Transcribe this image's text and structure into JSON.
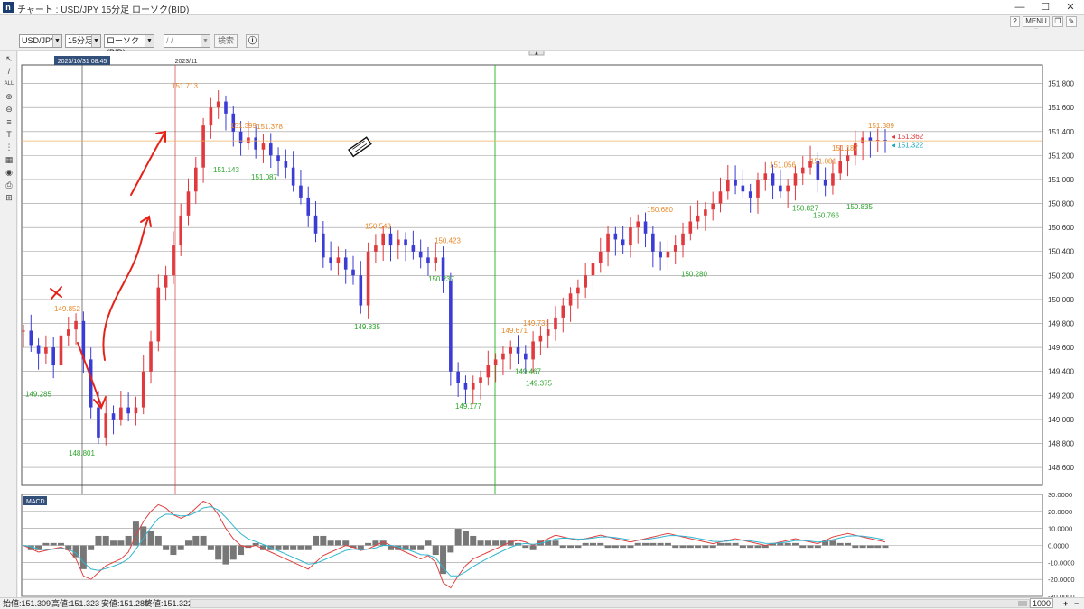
{
  "window": {
    "title": "チャート : USD/JPY 15分足 ローソク(BID)",
    "menu_label": "MENU ▾",
    "controls": {
      "min": "—",
      "max": "☐",
      "close": "✕"
    }
  },
  "toolbar": {
    "pair": "USD/JPY",
    "timeframe": "15分足",
    "chart_type": "ローソク(BID)",
    "date_value": " /  /",
    "search_label": "検索"
  },
  "chart": {
    "cursor_time": "2023/10/31 08:45",
    "period_label": "2023/11",
    "price_axis": [
      "151.800",
      "151.600",
      "151.400",
      "151.200",
      "151.000",
      "150.800",
      "150.600",
      "150.400",
      "150.200",
      "150.000",
      "149.800",
      "149.600",
      "149.400",
      "149.200",
      "149.000",
      "148.800",
      "148.600"
    ],
    "tag_bid": "151.362",
    "tag_ask": "151.322",
    "annotations_high": [
      {
        "label": "151.713"
      },
      {
        "label": "151.399"
      },
      {
        "label": "151.378"
      },
      {
        "label": "149.852"
      },
      {
        "label": "150.543"
      },
      {
        "label": "150.423"
      },
      {
        "label": "149.671"
      },
      {
        "label": "149.731"
      },
      {
        "label": "150.680"
      },
      {
        "label": "151.056"
      },
      {
        "label": "151.081"
      },
      {
        "label": "151.187"
      },
      {
        "label": "151.389"
      }
    ],
    "annotations_low": [
      {
        "label": "151.143"
      },
      {
        "label": "151.087"
      },
      {
        "label": "149.285"
      },
      {
        "label": "148.801"
      },
      {
        "label": "149.835"
      },
      {
        "label": "150.237"
      },
      {
        "label": "149.177"
      },
      {
        "label": "149.467"
      },
      {
        "label": "149.375"
      },
      {
        "label": "150.280"
      },
      {
        "label": "150.827"
      },
      {
        "label": "150.766"
      },
      {
        "label": "150.835"
      }
    ]
  },
  "macd": {
    "label": "MACD",
    "axis": [
      "30.0000",
      "20.0000",
      "10.0000",
      "0.0000",
      "-10.0000",
      "-20.0000",
      "-30.0000"
    ]
  },
  "status": {
    "open": "始値:151.309",
    "high": "高値:151.323",
    "low": "安値:151.280",
    "close": "終値:151.322",
    "bars": "1000"
  },
  "colors": {
    "up_candle": "#e0393e",
    "down_candle": "#3b3bd6",
    "high_label": "#e8892b",
    "low_label": "#2aa52a",
    "green_line": "#1db51d",
    "orange_line": "#f0b060",
    "red_line": "#d04040",
    "sketch_red": "#e52218"
  },
  "chart_data": {
    "type": "line",
    "title": "",
    "xlabel": "",
    "ylabel": "",
    "ylim": [
      148.5,
      151.95
    ],
    "x": [
      0,
      2,
      4,
      6,
      8,
      10,
      12,
      14,
      16,
      18,
      20,
      22,
      24,
      26,
      28,
      30,
      32,
      34,
      36,
      38,
      40,
      42,
      44,
      46,
      48,
      50,
      52,
      54,
      56,
      58,
      60,
      62,
      64,
      66,
      68,
      70,
      72,
      74,
      76,
      78,
      80,
      82,
      84,
      86,
      88,
      90,
      92,
      94,
      96,
      98,
      100,
      102,
      104,
      106,
      108,
      110,
      112,
      114,
      116,
      118,
      120,
      122,
      124,
      126,
      128,
      130,
      132,
      134,
      136,
      138,
      140,
      142,
      144,
      146,
      148,
      150,
      152,
      154,
      156,
      158,
      160,
      162,
      164,
      166,
      168,
      170,
      172,
      174,
      176,
      178,
      180,
      182,
      184,
      186,
      188,
      190,
      192,
      194,
      196,
      198,
      200,
      202,
      204,
      206,
      208,
      210,
      212,
      214,
      216,
      218,
      220,
      222,
      224,
      226,
      228,
      230
    ],
    "series": [
      {
        "values": [
          149.74,
          149.62,
          149.55,
          149.6,
          149.45,
          149.7,
          149.75,
          149.82,
          149.5,
          149.1,
          148.85,
          149.05,
          149.0,
          149.1,
          149.05,
          149.1,
          149.4,
          149.65,
          150.1,
          150.2,
          150.45,
          150.7,
          150.9,
          151.1,
          151.45,
          151.6,
          151.65,
          151.55,
          151.4,
          151.3,
          151.35,
          151.25,
          151.3,
          151.2,
          151.15,
          151.1,
          150.95,
          150.85,
          150.7,
          150.55,
          150.35,
          150.3,
          150.35,
          150.25,
          150.2,
          149.95,
          150.4,
          150.45,
          150.55,
          150.45,
          150.5,
          150.45,
          150.4,
          150.35,
          150.3,
          150.35,
          150.15,
          149.4,
          149.3,
          149.25,
          149.3,
          149.35,
          149.45,
          149.5,
          149.55,
          149.6,
          149.55,
          149.5,
          149.65,
          149.7,
          149.75,
          149.85,
          149.95,
          150.05,
          150.1,
          150.2,
          150.3,
          150.4,
          150.55,
          150.5,
          150.45,
          150.6,
          150.65,
          150.55,
          150.4,
          150.35,
          150.4,
          150.45,
          150.55,
          150.65,
          150.7,
          150.75,
          150.8,
          150.9,
          151.0,
          150.95,
          150.9,
          150.85,
          151.0,
          151.05,
          150.95,
          150.9,
          150.95,
          151.05,
          151.1,
          151.15,
          151.0,
          150.95,
          151.05,
          151.15,
          151.2,
          151.3,
          151.35,
          151.32,
          151.33,
          151.32
        ]
      },
      {
        "name": "MACD",
        "values": [
          0,
          -2,
          -4,
          -3,
          -2,
          -1,
          -3,
          -8,
          -18,
          -20,
          -16,
          -12,
          -10,
          -8,
          -4,
          6,
          14,
          20,
          24,
          22,
          18,
          16,
          18,
          22,
          26,
          24,
          18,
          10,
          4,
          0,
          -1,
          0,
          -2,
          -4,
          -6,
          -8,
          -10,
          -12,
          -14,
          -10,
          -6,
          -4,
          -2,
          0,
          -1,
          -3,
          -2,
          0,
          2,
          0,
          -2,
          -4,
          -6,
          -8,
          -6,
          -10,
          -22,
          -25,
          -18,
          -12,
          -8,
          -6,
          -4,
          -2,
          0,
          2,
          3,
          2,
          0,
          2,
          4,
          6,
          5,
          4,
          3,
          4,
          5,
          6,
          5,
          4,
          3,
          2,
          3,
          4,
          5,
          6,
          7,
          6,
          5,
          4,
          3,
          2,
          1,
          2,
          3,
          4,
          3,
          2,
          1,
          0,
          1,
          2,
          3,
          4,
          3,
          2,
          1,
          3,
          5,
          6,
          7,
          6,
          5,
          4,
          3,
          2
        ]
      }
    ]
  }
}
